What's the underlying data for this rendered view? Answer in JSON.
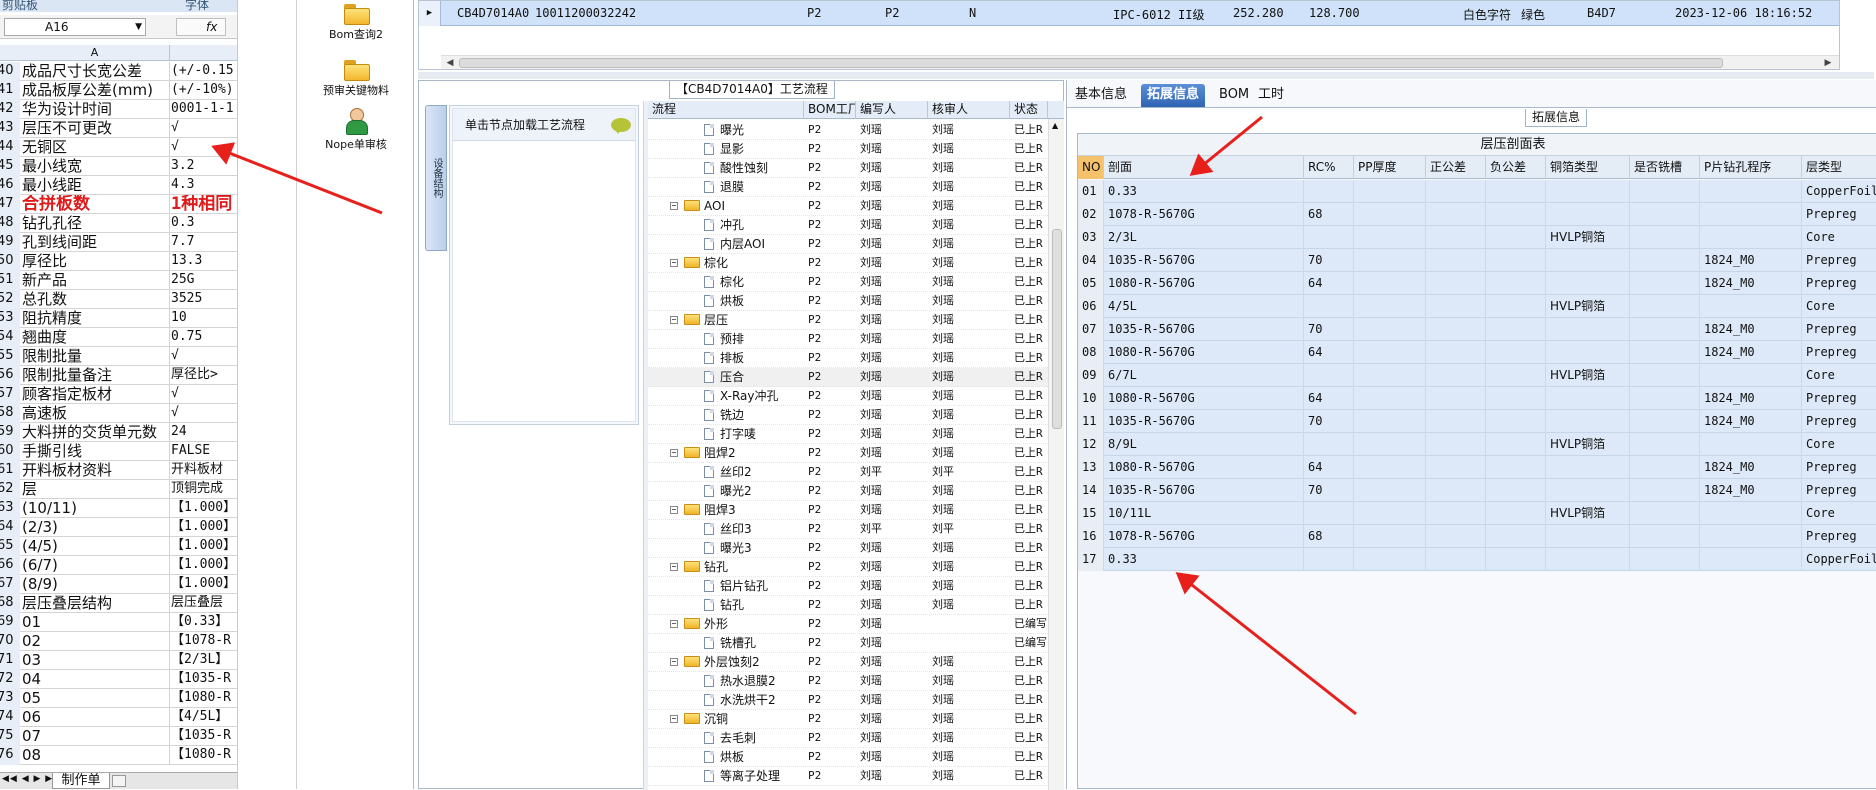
{
  "excel": {
    "ribbon": {
      "left": "剪贴板",
      "right": "字体"
    },
    "namebox": "A16",
    "fx": "fx",
    "column_a": "A",
    "rows": [
      {
        "num": "40",
        "a": "成品尺寸长宽公差",
        "b": "(+/-0.15"
      },
      {
        "num": "41",
        "a": "成品板厚公差(mm)",
        "b": "(+/-10%)"
      },
      {
        "num": "42",
        "a": "华为设计时间",
        "b": "0001-1-1"
      },
      {
        "num": "43",
        "a": "层压不可更改",
        "b": "√"
      },
      {
        "num": "44",
        "a": "无铜区",
        "b": "√"
      },
      {
        "num": "45",
        "a": "最小线宽",
        "b": "3.2"
      },
      {
        "num": "46",
        "a": "最小线距",
        "b": "4.3"
      },
      {
        "num": "47",
        "a": "合拼板数",
        "b": "1种相同",
        "red": true
      },
      {
        "num": "48",
        "a": "钻孔孔径",
        "b": "0.3"
      },
      {
        "num": "49",
        "a": "孔到线间距",
        "b": "7.7"
      },
      {
        "num": "50",
        "a": "厚径比",
        "b": "13.3"
      },
      {
        "num": "51",
        "a": "新产品",
        "b": "25G"
      },
      {
        "num": "52",
        "a": "总孔数",
        "b": "3525"
      },
      {
        "num": "53",
        "a": "阻抗精度",
        "b": "10"
      },
      {
        "num": "54",
        "a": "翘曲度",
        "b": "0.75"
      },
      {
        "num": "55",
        "a": "限制批量",
        "b": "√"
      },
      {
        "num": "56",
        "a": "限制批量备注",
        "b": "厚径比>"
      },
      {
        "num": "57",
        "a": "顾客指定板材",
        "b": "√"
      },
      {
        "num": "58",
        "a": "高速板",
        "b": "√"
      },
      {
        "num": "59",
        "a": "大料拼的交货单元数",
        "b": "24"
      },
      {
        "num": "60",
        "a": "手撕引线",
        "b": "FALSE"
      },
      {
        "num": "61",
        "a": "开料板材资料",
        "b": "开料板材"
      },
      {
        "num": "62",
        "a": "层",
        "b": "顶铜完成"
      },
      {
        "num": "63",
        "a": "(10/11)",
        "b": "【1.000】"
      },
      {
        "num": "64",
        "a": "(2/3)",
        "b": "【1.000】"
      },
      {
        "num": "65",
        "a": "(4/5)",
        "b": "【1.000】"
      },
      {
        "num": "66",
        "a": "(6/7)",
        "b": "【1.000】"
      },
      {
        "num": "67",
        "a": "(8/9)",
        "b": "【1.000】"
      },
      {
        "num": "68",
        "a": "层压叠层结构",
        "b": "层压叠层"
      },
      {
        "num": "69",
        "a": "01",
        "b": "【0.33】"
      },
      {
        "num": "70",
        "a": "02",
        "b": "【1078-R"
      },
      {
        "num": "71",
        "a": "03",
        "b": "【2/3L】"
      },
      {
        "num": "72",
        "a": "04",
        "b": "【1035-R"
      },
      {
        "num": "73",
        "a": "05",
        "b": "【1080-R"
      },
      {
        "num": "74",
        "a": "06",
        "b": "【4/5L】"
      },
      {
        "num": "75",
        "a": "07",
        "b": "【1035-R"
      },
      {
        "num": "76",
        "a": "08",
        "b": "【1080-R"
      }
    ],
    "sheet_tab": "制作单"
  },
  "launcher": {
    "items": [
      {
        "label": "Bom查询2",
        "icon": "folder-icon"
      },
      {
        "label": "预审关键物料",
        "icon": "folder-icon"
      },
      {
        "label": "Nope单审核",
        "icon": "person-icon"
      }
    ]
  },
  "top_grid": {
    "row": [
      "CB4D7014A0",
      "10011200032242",
      "P2",
      "P2",
      "N",
      "IPC-6012 II级",
      "252.280",
      "128.700",
      "白色字符",
      "绿色",
      "B4D7",
      "2023-12-06 18:16:52"
    ]
  },
  "process": {
    "title": "【CB4D7014A0】工艺流程",
    "vertical_tab": "设备结构",
    "hint": "单击节点加载工艺流程",
    "columns": [
      "流程",
      "BOM工厂",
      "编写人",
      "核审人",
      "状态"
    ],
    "rows": [
      {
        "name": "曝光",
        "level": 2,
        "factory": "P2",
        "writer": "刘瑶",
        "reviewer": "刘瑶",
        "status": "已上R"
      },
      {
        "name": "显影",
        "level": 2,
        "factory": "P2",
        "writer": "刘瑶",
        "reviewer": "刘瑶",
        "status": "已上R"
      },
      {
        "name": "酸性蚀刻",
        "level": 2,
        "factory": "P2",
        "writer": "刘瑶",
        "reviewer": "刘瑶",
        "status": "已上R"
      },
      {
        "name": "退膜",
        "level": 2,
        "factory": "P2",
        "writer": "刘瑶",
        "reviewer": "刘瑶",
        "status": "已上R"
      },
      {
        "name": "AOI",
        "level": 1,
        "factory": "P2",
        "writer": "刘瑶",
        "reviewer": "刘瑶",
        "status": "已上R"
      },
      {
        "name": "冲孔",
        "level": 2,
        "factory": "P2",
        "writer": "刘瑶",
        "reviewer": "刘瑶",
        "status": "已上R"
      },
      {
        "name": "内层AOI",
        "level": 2,
        "factory": "P2",
        "writer": "刘瑶",
        "reviewer": "刘瑶",
        "status": "已上R"
      },
      {
        "name": "棕化",
        "level": 1,
        "factory": "P2",
        "writer": "刘瑶",
        "reviewer": "刘瑶",
        "status": "已上R"
      },
      {
        "name": "棕化",
        "level": 2,
        "factory": "P2",
        "writer": "刘瑶",
        "reviewer": "刘瑶",
        "status": "已上R"
      },
      {
        "name": "烘板",
        "level": 2,
        "factory": "P2",
        "writer": "刘瑶",
        "reviewer": "刘瑶",
        "status": "已上R"
      },
      {
        "name": "层压",
        "level": 1,
        "factory": "P2",
        "writer": "刘瑶",
        "reviewer": "刘瑶",
        "status": "已上R"
      },
      {
        "name": "预排",
        "level": 2,
        "factory": "P2",
        "writer": "刘瑶",
        "reviewer": "刘瑶",
        "status": "已上R"
      },
      {
        "name": "排板",
        "level": 2,
        "factory": "P2",
        "writer": "刘瑶",
        "reviewer": "刘瑶",
        "status": "已上R"
      },
      {
        "name": "压合",
        "level": 2,
        "factory": "P2",
        "writer": "刘瑶",
        "reviewer": "刘瑶",
        "status": "已上R",
        "selected": true
      },
      {
        "name": "X-Ray冲孔",
        "level": 2,
        "factory": "P2",
        "writer": "刘瑶",
        "reviewer": "刘瑶",
        "status": "已上R"
      },
      {
        "name": "铣边",
        "level": 2,
        "factory": "P2",
        "writer": "刘瑶",
        "reviewer": "刘瑶",
        "status": "已上R"
      },
      {
        "name": "打字唛",
        "level": 2,
        "factory": "P2",
        "writer": "刘瑶",
        "reviewer": "刘瑶",
        "status": "已上R"
      },
      {
        "name": "阻焊2",
        "level": 1,
        "factory": "P2",
        "writer": "刘瑶",
        "reviewer": "刘瑶",
        "status": "已上R"
      },
      {
        "name": "丝印2",
        "level": 2,
        "factory": "P2",
        "writer": "刘平",
        "reviewer": "刘平",
        "status": "已上R"
      },
      {
        "name": "曝光2",
        "level": 2,
        "factory": "P2",
        "writer": "刘瑶",
        "reviewer": "刘瑶",
        "status": "已上R"
      },
      {
        "name": "阻焊3",
        "level": 1,
        "factory": "P2",
        "writer": "刘瑶",
        "reviewer": "刘瑶",
        "status": "已上R"
      },
      {
        "name": "丝印3",
        "level": 2,
        "factory": "P2",
        "writer": "刘平",
        "reviewer": "刘平",
        "status": "已上R"
      },
      {
        "name": "曝光3",
        "level": 2,
        "factory": "P2",
        "writer": "刘瑶",
        "reviewer": "刘瑶",
        "status": "已上R"
      },
      {
        "name": "钻孔",
        "level": 1,
        "factory": "P2",
        "writer": "刘瑶",
        "reviewer": "刘瑶",
        "status": "已上R"
      },
      {
        "name": "铝片钻孔",
        "level": 2,
        "factory": "P2",
        "writer": "刘瑶",
        "reviewer": "刘瑶",
        "status": "已上R"
      },
      {
        "name": "钻孔",
        "level": 2,
        "factory": "P2",
        "writer": "刘瑶",
        "reviewer": "刘瑶",
        "status": "已上R"
      },
      {
        "name": "外形",
        "level": 1,
        "factory": "P2",
        "writer": "刘瑶",
        "reviewer": "",
        "status": "已编写"
      },
      {
        "name": "铣槽孔",
        "level": 2,
        "factory": "P2",
        "writer": "刘瑶",
        "reviewer": "",
        "status": "已编写"
      },
      {
        "name": "外层蚀刻2",
        "level": 1,
        "factory": "P2",
        "writer": "刘瑶",
        "reviewer": "刘瑶",
        "status": "已上R"
      },
      {
        "name": "热水退膜2",
        "level": 2,
        "factory": "P2",
        "writer": "刘瑶",
        "reviewer": "刘瑶",
        "status": "已上R"
      },
      {
        "name": "水洗烘干2",
        "level": 2,
        "factory": "P2",
        "writer": "刘瑶",
        "reviewer": "刘瑶",
        "status": "已上R"
      },
      {
        "name": "沉铜",
        "level": 1,
        "factory": "P2",
        "writer": "刘瑶",
        "reviewer": "刘瑶",
        "status": "已上R"
      },
      {
        "name": "去毛刺",
        "level": 2,
        "factory": "P2",
        "writer": "刘瑶",
        "reviewer": "刘瑶",
        "status": "已上R"
      },
      {
        "name": "烘板",
        "level": 2,
        "factory": "P2",
        "writer": "刘瑶",
        "reviewer": "刘瑶",
        "status": "已上R"
      },
      {
        "name": "等离子处理",
        "level": 2,
        "factory": "P2",
        "writer": "刘瑶",
        "reviewer": "刘瑶",
        "status": "已上R"
      }
    ]
  },
  "right": {
    "tabs": [
      "基本信息",
      "拓展信息",
      "BOM",
      "工时"
    ],
    "active_tab": 1,
    "caption": "拓展信息",
    "table_title": "层压剖面表",
    "columns": [
      "NO",
      "剖面",
      "RC%",
      "PP厚度",
      "正公差",
      "负公差",
      "铜箔类型",
      "是否铣槽",
      "P片钻孔程序",
      "层类型"
    ],
    "rows": [
      [
        "01",
        "0.33",
        "",
        "",
        "",
        "",
        "",
        "",
        "",
        "CopperFoil"
      ],
      [
        "02",
        "1078-R-5670G",
        "68",
        "",
        "",
        "",
        "",
        "",
        "",
        "Prepreg"
      ],
      [
        "03",
        "2/3L",
        "",
        "",
        "",
        "",
        "HVLP铜箔",
        "",
        "",
        "Core"
      ],
      [
        "04",
        "1035-R-5670G",
        "70",
        "",
        "",
        "",
        "",
        "",
        "1824_M0",
        "Prepreg"
      ],
      [
        "05",
        "1080-R-5670G",
        "64",
        "",
        "",
        "",
        "",
        "",
        "1824_M0",
        "Prepreg"
      ],
      [
        "06",
        "4/5L",
        "",
        "",
        "",
        "",
        "HVLP铜箔",
        "",
        "",
        "Core"
      ],
      [
        "07",
        "1035-R-5670G",
        "70",
        "",
        "",
        "",
        "",
        "",
        "1824_M0",
        "Prepreg"
      ],
      [
        "08",
        "1080-R-5670G",
        "64",
        "",
        "",
        "",
        "",
        "",
        "1824_M0",
        "Prepreg"
      ],
      [
        "09",
        "6/7L",
        "",
        "",
        "",
        "",
        "HVLP铜箔",
        "",
        "",
        "Core"
      ],
      [
        "10",
        "1080-R-5670G",
        "64",
        "",
        "",
        "",
        "",
        "",
        "1824_M0",
        "Prepreg"
      ],
      [
        "11",
        "1035-R-5670G",
        "70",
        "",
        "",
        "",
        "",
        "",
        "1824_M0",
        "Prepreg"
      ],
      [
        "12",
        "8/9L",
        "",
        "",
        "",
        "",
        "HVLP铜箔",
        "",
        "",
        "Core"
      ],
      [
        "13",
        "1080-R-5670G",
        "64",
        "",
        "",
        "",
        "",
        "",
        "1824_M0",
        "Prepreg"
      ],
      [
        "14",
        "1035-R-5670G",
        "70",
        "",
        "",
        "",
        "",
        "",
        "1824_M0",
        "Prepreg"
      ],
      [
        "15",
        "10/11L",
        "",
        "",
        "",
        "",
        "HVLP铜箔",
        "",
        "",
        "Core"
      ],
      [
        "16",
        "1078-R-5670G",
        "68",
        "",
        "",
        "",
        "",
        "",
        "",
        "Prepreg"
      ],
      [
        "17",
        "0.33",
        "",
        "",
        "",
        "",
        "",
        "",
        "",
        "CopperFoil"
      ]
    ]
  },
  "colors": {
    "annotation_arrow": "#e8201c",
    "selected_row": "#cfe2f9",
    "active_tab": "#2f64b3"
  }
}
